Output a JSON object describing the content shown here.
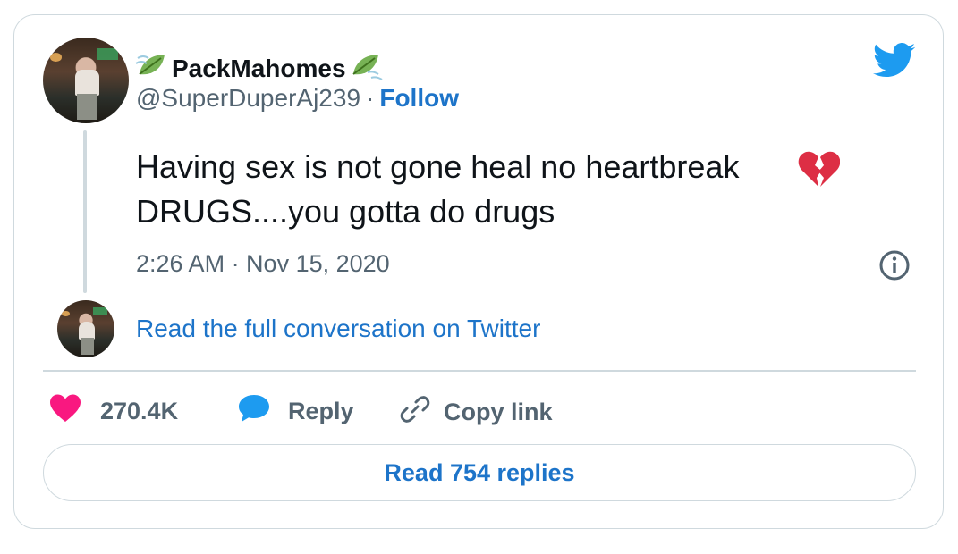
{
  "author": {
    "display_name": "PackMahomes",
    "name_emoji": "leaf-in-wind-emoji",
    "handle": "@SuperDuperAj239",
    "separator": "·",
    "follow_label": "Follow"
  },
  "tweet": {
    "text": "Having sex is not gone heal no heartbreak\nDRUGS....you gotta do drugs",
    "emoji": "broken-heart-emoji",
    "timestamp": "2:26 AM · Nov 15, 2020"
  },
  "conversation_link": "Read the full conversation on Twitter",
  "actions": {
    "likes": "270.4K",
    "reply_label": "Reply",
    "copy_label": "Copy link"
  },
  "replies_button": "Read 754 replies",
  "colors": {
    "link_blue": "#1d74c9",
    "twitter_blue": "#1d9bf0",
    "heart_pink": "#f91880",
    "muted": "#536471",
    "border": "#cfd9de"
  }
}
